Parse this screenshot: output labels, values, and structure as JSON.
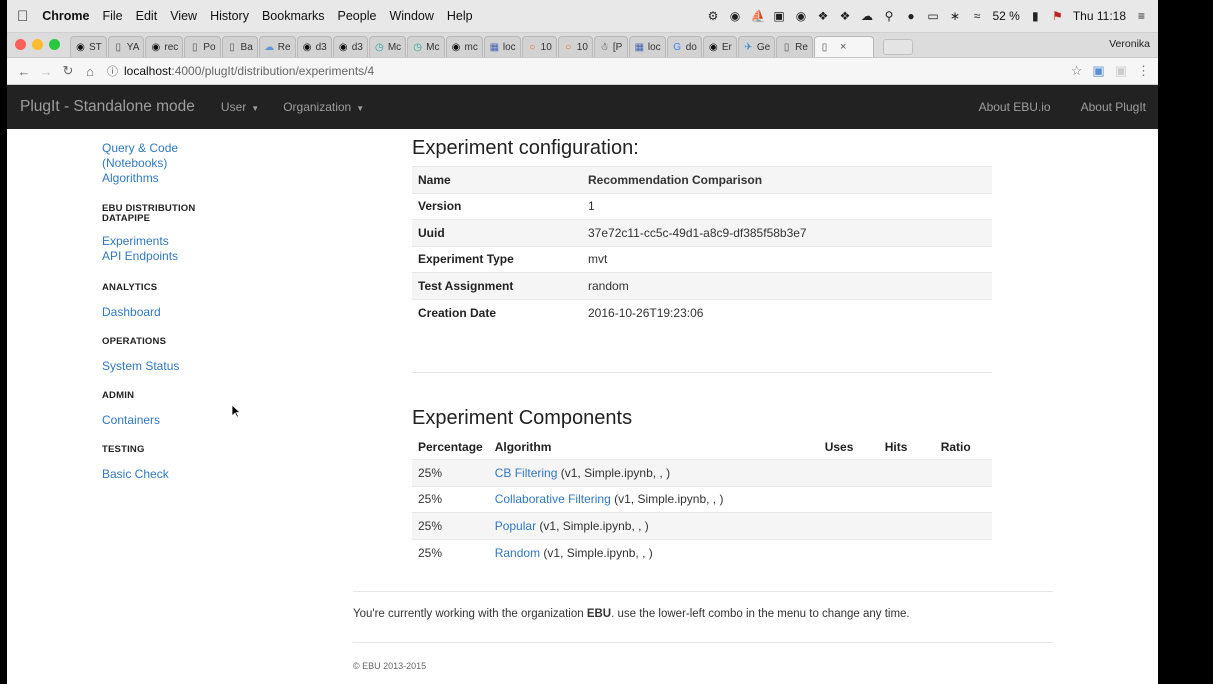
{
  "menubar": {
    "app_name": "Chrome",
    "items": [
      "File",
      "Edit",
      "View",
      "History",
      "Bookmarks",
      "People",
      "Window",
      "Help"
    ],
    "battery": "52 %",
    "clock": "Thu 11:18"
  },
  "tabs": [
    {
      "label": "ST",
      "icon": "github-icon"
    },
    {
      "label": "YA",
      "icon": "page-icon"
    },
    {
      "label": "rec",
      "icon": "github-icon"
    },
    {
      "label": "Po",
      "icon": "page-icon"
    },
    {
      "label": "Ba",
      "icon": "page-icon"
    },
    {
      "label": "Re",
      "icon": "cloud-icon"
    },
    {
      "label": "d3",
      "icon": "github-icon"
    },
    {
      "label": "d3",
      "icon": "github-icon"
    },
    {
      "label": "Mc",
      "icon": "clock-icon"
    },
    {
      "label": "Mc",
      "icon": "clock-icon"
    },
    {
      "label": "mc",
      "icon": "github-icon"
    },
    {
      "label": "loc",
      "icon": "grid-icon"
    },
    {
      "label": "10",
      "icon": "ring-icon"
    },
    {
      "label": "10",
      "icon": "ring-icon"
    },
    {
      "label": "[P",
      "icon": "robot-icon"
    },
    {
      "label": "loc",
      "icon": "grid-icon"
    },
    {
      "label": "do",
      "icon": "google-icon"
    },
    {
      "label": "Er",
      "icon": "github-icon"
    },
    {
      "label": "Ge",
      "icon": "bird-icon"
    },
    {
      "label": "Re",
      "icon": "page-icon"
    },
    {
      "label": "",
      "icon": "page-icon",
      "active": true
    }
  ],
  "profile_name": "Veronika",
  "address": {
    "host": "localhost",
    "path": ":4000/plugIt/distribution/experiments/4"
  },
  "navbar": {
    "brand": "PlugIt - Standalone mode",
    "left": [
      "User",
      "Organization"
    ],
    "right": [
      "About EBU.io",
      "About PlugIt"
    ]
  },
  "sidebar": {
    "top_links": [
      "Query & Code (Notebooks)",
      "Algorithms"
    ],
    "sections": [
      {
        "heading": "EBU DISTRIBUTION DATAPIPE",
        "links": [
          "Experiments",
          "API Endpoints"
        ]
      },
      {
        "heading": "ANALYTICS",
        "links": [
          "Dashboard"
        ]
      },
      {
        "heading": "OPERATIONS",
        "links": [
          "System Status"
        ]
      },
      {
        "heading": "ADMIN",
        "links": [
          "Containers"
        ]
      },
      {
        "heading": "TESTING",
        "links": [
          "Basic Check"
        ]
      }
    ]
  },
  "config": {
    "title": "Experiment configuration:",
    "rows": [
      {
        "key": "Name",
        "value": "Recommendation Comparison"
      },
      {
        "key": "Version",
        "value": "1"
      },
      {
        "key": "Uuid",
        "value": "37e72c11-cc5c-49d1-a8c9-df385f58b3e7"
      },
      {
        "key": "Experiment Type",
        "value": "mvt"
      },
      {
        "key": "Test Assignment",
        "value": "random"
      },
      {
        "key": "Creation Date",
        "value": "2016-10-26T19:23:06"
      }
    ]
  },
  "components": {
    "title": "Experiment Components",
    "headers": [
      "Percentage",
      "Algorithm",
      "Uses",
      "Hits",
      "Ratio"
    ],
    "rows": [
      {
        "percentage": "25%",
        "algorithm": "CB Filtering",
        "details": " (v1, Simple.ipynb, , )"
      },
      {
        "percentage": "25%",
        "algorithm": "Collaborative Filtering",
        "details": " (v1, Simple.ipynb, , )"
      },
      {
        "percentage": "25%",
        "algorithm": "Popular",
        "details": " (v1, Simple.ipynb, , )"
      },
      {
        "percentage": "25%",
        "algorithm": "Random",
        "details": " (v1, Simple.ipynb, , )"
      }
    ]
  },
  "footer": {
    "text_before": "You're currently working with the organization ",
    "org": "EBU",
    "text_after": ". use the lower-left combo in the menu to change any time.",
    "copyright": "© EBU 2013-2015"
  }
}
